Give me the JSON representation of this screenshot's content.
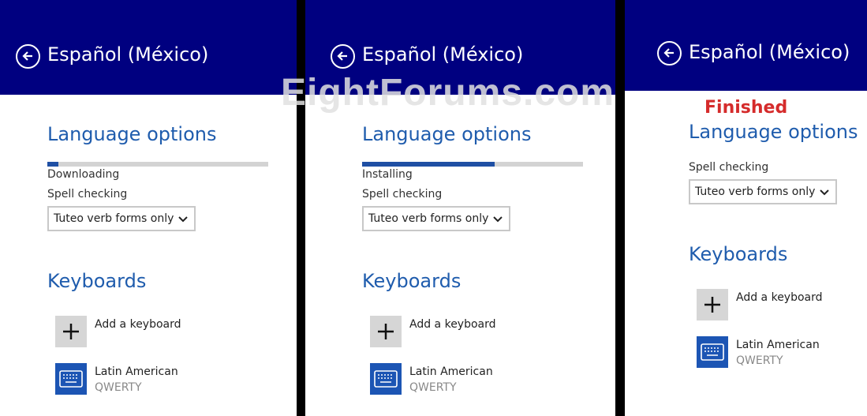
{
  "panels": [
    {
      "title": "Español (México)",
      "language_options": "Language options",
      "status": "Downloading",
      "progress": 0.05,
      "spell_label": "Spell checking",
      "spell_value": "Tuteo verb forms only",
      "keyboards": "Keyboards",
      "add_keyboard": "Add a keyboard",
      "keyboard_name": "Latin American",
      "keyboard_layout": "QWERTY"
    },
    {
      "title": "Español (México)",
      "language_options": "Language options",
      "status": "Installing",
      "progress": 0.6,
      "spell_label": "Spell checking",
      "spell_value": "Tuteo verb forms only",
      "keyboards": "Keyboards",
      "add_keyboard": "Add a keyboard",
      "keyboard_name": "Latin American",
      "keyboard_layout": "QWERTY"
    },
    {
      "title": "Español (México)",
      "finished": "Finished",
      "language_options": "Language options",
      "spell_label": "Spell checking",
      "spell_value": "Tuteo verb forms only",
      "keyboards": "Keyboards",
      "add_keyboard": "Add a keyboard",
      "keyboard_name": "Latin American",
      "keyboard_layout": "QWERTY"
    }
  ],
  "watermark": "EightForums.com",
  "icons": {
    "back": "back-arrow-icon",
    "add": "plus-icon",
    "keyboard": "keyboard-icon",
    "dropdown": "chevron-down-icon"
  },
  "colors": {
    "header": "#000080",
    "accent": "#1f5cad",
    "progress": "#1f4fa4",
    "finished": "#d52b2b",
    "keyboard_tile": "#1c55b4"
  }
}
